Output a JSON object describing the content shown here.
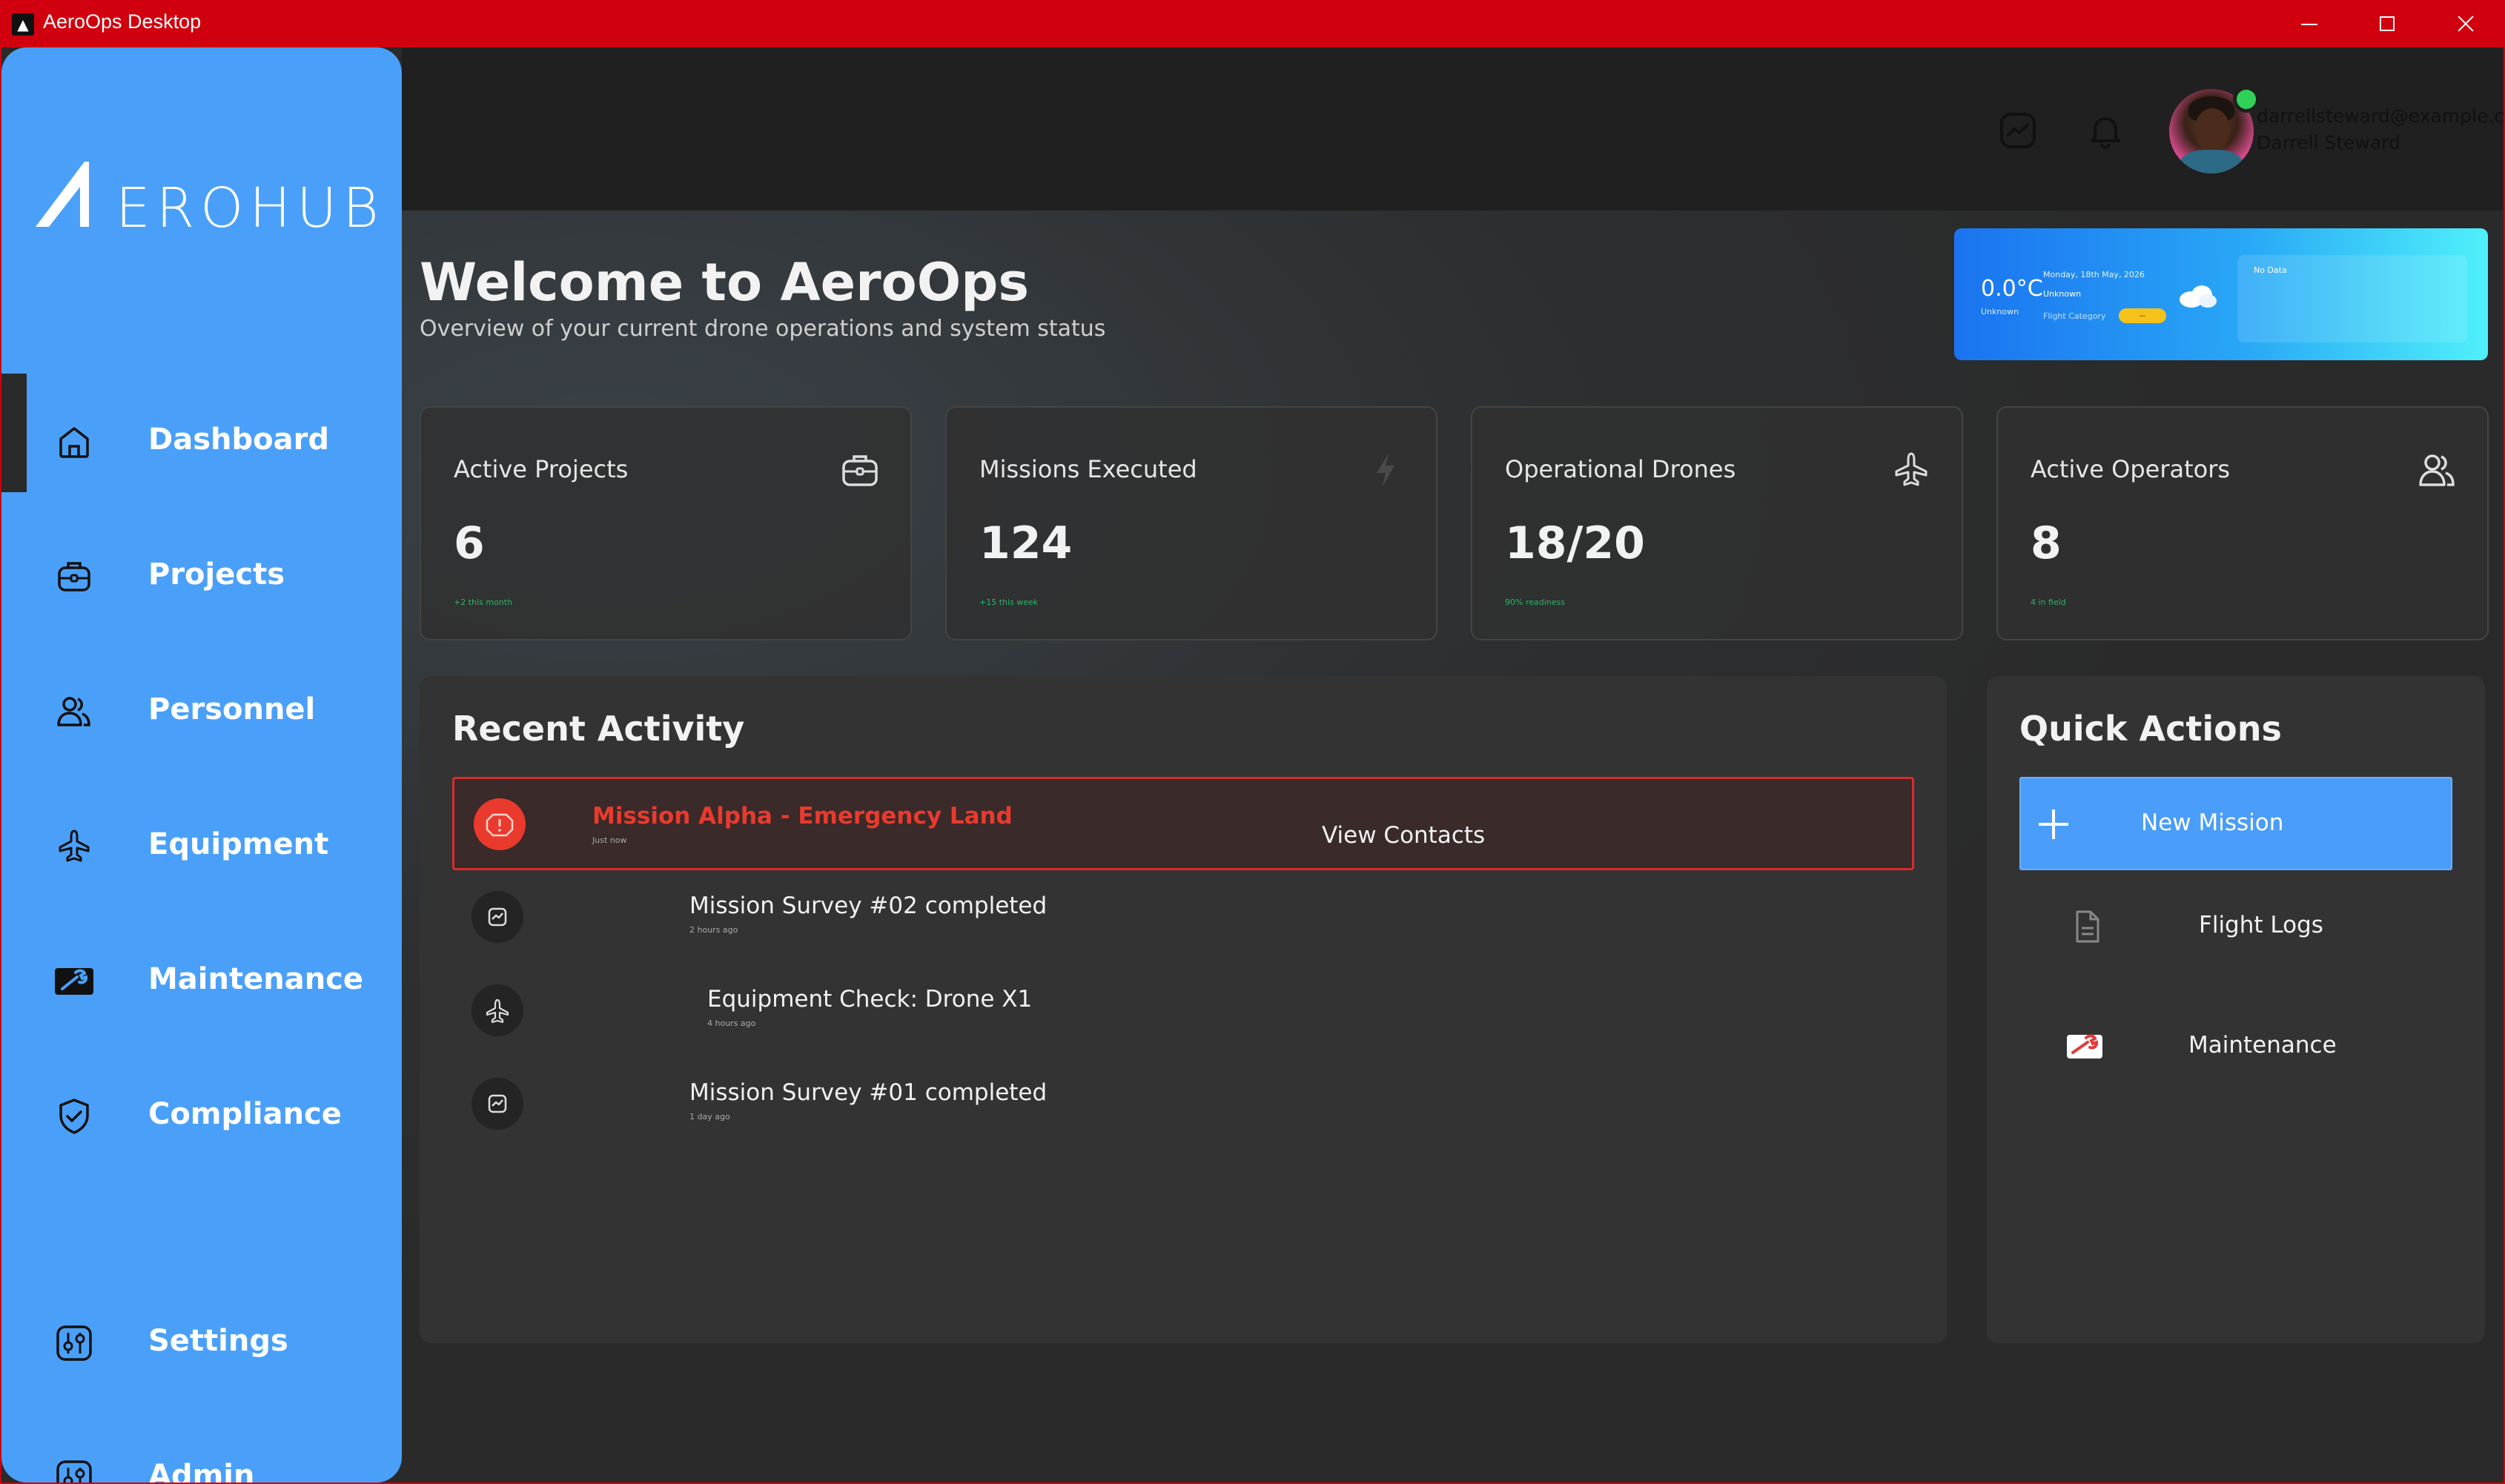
{
  "window": {
    "title": "AeroOps Desktop"
  },
  "brand": {
    "logo_text": "EROHUB"
  },
  "sidebar": {
    "items": [
      {
        "label": "Dashboard",
        "icon": "home-icon",
        "active": true
      },
      {
        "label": "Projects",
        "icon": "briefcase-icon"
      },
      {
        "label": "Personnel",
        "icon": "users-icon"
      },
      {
        "label": "Equipment",
        "icon": "plane-icon"
      },
      {
        "label": "Maintenance",
        "icon": "wrench-icon"
      },
      {
        "label": "Compliance",
        "icon": "shield-check-icon"
      }
    ],
    "bottom_items": [
      {
        "label": "Settings",
        "icon": "settings-sliders-icon"
      },
      {
        "label": "Admin",
        "icon": "settings-sliders-icon"
      }
    ]
  },
  "header": {
    "user_email": "darrellsteward@example.com",
    "user_name": "Darrell Steward"
  },
  "page": {
    "title": "Welcome to AeroOps",
    "subtitle": "Overview of your current drone operations and system status"
  },
  "weather": {
    "temperature": "0.0°C",
    "temperature_sub": "Unknown",
    "date": "Monday, 18th May, 2026",
    "condition": "Unknown",
    "flight_category_label": "Flight Category",
    "flight_category_value": "--",
    "no_data": "No Data"
  },
  "stats": [
    {
      "title": "Active Projects",
      "value": "6",
      "note": "+2 this month",
      "icon": "briefcase-icon"
    },
    {
      "title": "Missions Executed",
      "value": "124",
      "note": "+15 this week",
      "icon": "lightning-icon"
    },
    {
      "title": "Operational Drones",
      "value": "18/20",
      "note": "90% readiness",
      "icon": "plane-icon"
    },
    {
      "title": "Active Operators",
      "value": "8",
      "note": "4 in field",
      "icon": "users-icon"
    }
  ],
  "recent_activity": {
    "title": "Recent Activity",
    "alert": {
      "title": "Mission Alpha - Emergency Land",
      "time": "Just now",
      "action": "View Contacts"
    },
    "items": [
      {
        "title": "Mission Survey #02 completed",
        "time": "2 hours ago",
        "icon": "chart-icon"
      },
      {
        "title": "Equipment Check: Drone X1",
        "time": "4 hours ago",
        "icon": "plane-icon"
      },
      {
        "title": "Mission Survey #01 completed",
        "time": "1 day ago",
        "icon": "chart-icon"
      }
    ]
  },
  "quick_actions": {
    "title": "Quick Actions",
    "primary": {
      "label": "New Mission",
      "icon": "plus-icon"
    },
    "items": [
      {
        "label": "Flight Logs",
        "icon": "document-icon"
      },
      {
        "label": "Maintenance",
        "icon": "wrench-icon"
      }
    ]
  },
  "colors": {
    "titlebar": "#d0000f",
    "sidebar": "#4aa0f9",
    "alert": "#ea3a2d",
    "positive": "#2fb36a",
    "primary_button": "#4a9df8"
  }
}
